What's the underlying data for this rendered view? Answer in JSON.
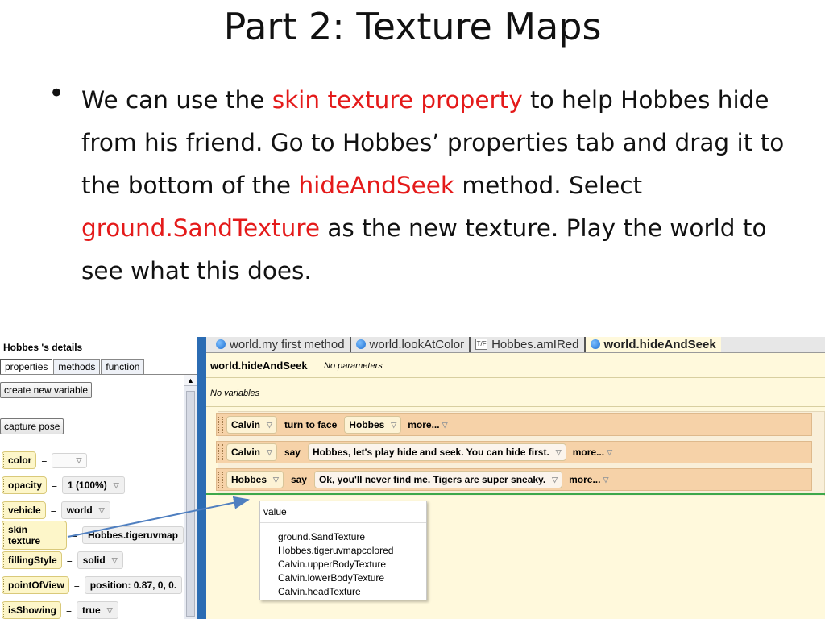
{
  "slide": {
    "title": "Part 2: Texture Maps",
    "bullet": {
      "t1": "We can use the ",
      "r1": "skin texture property",
      "t2": " to help Hobbes hide from his friend. Go to Hobbes’ properties tab and drag it to the bottom of the ",
      "r2": "hideAndSeek",
      "t3": " method. Select ",
      "r3": "ground.SandTexture",
      "t4": " as the new texture. Play the world to see what this does."
    },
    "highlight_color": "#e41a1a"
  },
  "details_panel": {
    "title": "Hobbes 's details",
    "tabs": [
      "properties",
      "methods",
      "function"
    ],
    "create_variable_button": "create new variable",
    "capture_pose_button": "capture pose",
    "properties": [
      {
        "name": "color",
        "value": ""
      },
      {
        "name": "opacity",
        "value": "1 (100%)"
      },
      {
        "name": "vehicle",
        "value": "world"
      },
      {
        "name": "skin texture",
        "value": "Hobbes.tigeruvmap"
      },
      {
        "name": "fillingStyle",
        "value": "solid"
      },
      {
        "name": "pointOfView",
        "value": "position: 0.87, 0, 0."
      },
      {
        "name": "isShowing",
        "value": "true"
      }
    ],
    "equals": "="
  },
  "editor": {
    "tabs": [
      {
        "label": "world.my first method",
        "icon": "globe-icon"
      },
      {
        "label": "world.lookAtColor",
        "icon": "globe-icon"
      },
      {
        "label": "Hobbes.amIRed",
        "icon": "boolean-function-icon",
        "icon_text": "T/F"
      },
      {
        "label": "world.hideAndSeek",
        "icon": "globe-icon"
      }
    ],
    "method_name": "world.hideAndSeek",
    "parameters": "No parameters",
    "variables": "No variables",
    "statements": [
      {
        "object": "Calvin",
        "verb": "turn to face",
        "arg": "Hobbes",
        "more": "more..."
      },
      {
        "object": "Calvin",
        "verb": "say",
        "arg": "Hobbes, let's play hide and seek. You can hide first.",
        "more": "more..."
      },
      {
        "object": "Hobbes",
        "verb": "say",
        "arg": "Ok, you'll never find me. Tigers are super sneaky.",
        "more": "more..."
      }
    ]
  },
  "dropdown": {
    "title": "value",
    "items": [
      "ground.SandTexture",
      "Hobbes.tigeruvmapcolored",
      "Calvin.upperBodyTexture",
      "Calvin.lowerBodyTexture",
      "Calvin.headTexture"
    ]
  }
}
